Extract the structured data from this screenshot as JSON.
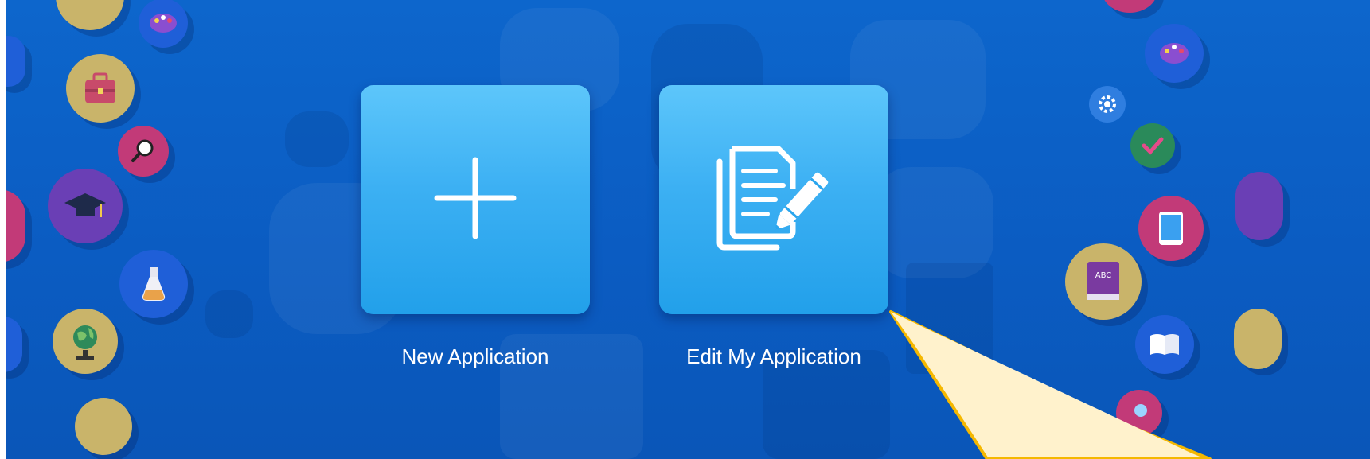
{
  "tiles": [
    {
      "label": "New Application",
      "icon": "plus-icon"
    },
    {
      "label": "Edit My Application",
      "icon": "document-edit-icon"
    }
  ],
  "decorations": {
    "book_text": "ABC"
  },
  "colors": {
    "background": "#0b5cc2",
    "tile_top": "#5dc6fb",
    "tile_bottom": "#22a0ea",
    "callout_fill": "#fff2cc",
    "callout_stroke": "#f5b800"
  }
}
